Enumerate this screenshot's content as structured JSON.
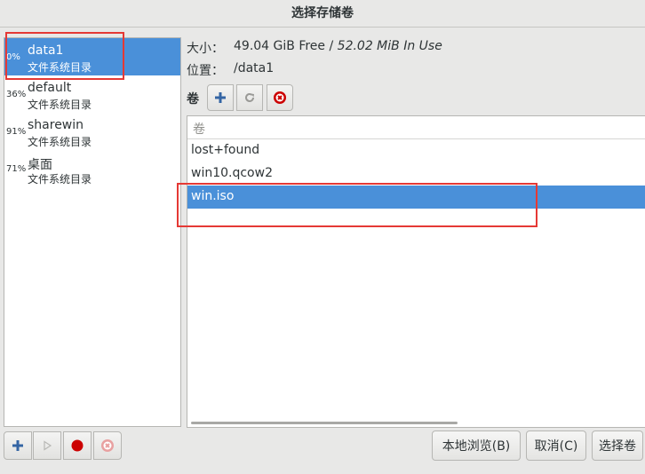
{
  "window": {
    "title": "选择存储卷"
  },
  "pools": [
    {
      "percent": "0%",
      "name": "data1",
      "type": "文件系统目录",
      "selected": true
    },
    {
      "percent": "36%",
      "name": "default",
      "type": "文件系统目录",
      "selected": false
    },
    {
      "percent": "91%",
      "name": "sharewin",
      "type": "文件系统目录",
      "selected": false
    },
    {
      "percent": "71%",
      "name": "桌面",
      "type": "文件系统目录",
      "selected": false
    }
  ],
  "info": {
    "size_label": "大小：",
    "size_value": "49.04 GiB Free / ",
    "size_in_use": "52.02 MiB In Use",
    "location_label": "位置：",
    "location_value": "/data1"
  },
  "volumes": {
    "section_label": "卷",
    "column_header": "卷",
    "rows": [
      "lost+found",
      "win10.qcow2",
      "win.iso"
    ],
    "selected_index": 2
  },
  "actions": {
    "browse_local": "本地浏览(B)",
    "cancel": "取消(C)",
    "choose_volume": "选择卷"
  },
  "colors": {
    "selection": "#4a90d9",
    "highlight_box": "#e53935",
    "add_icon": "#3465a4",
    "stop_icon": "#cc0000"
  },
  "icons": {
    "volume_add": "plus-icon",
    "volume_refresh": "refresh-icon",
    "volume_delete": "delete-icon",
    "pool_add": "plus-icon",
    "pool_start": "play-icon",
    "pool_stop": "record-icon",
    "pool_delete": "delete-icon"
  }
}
